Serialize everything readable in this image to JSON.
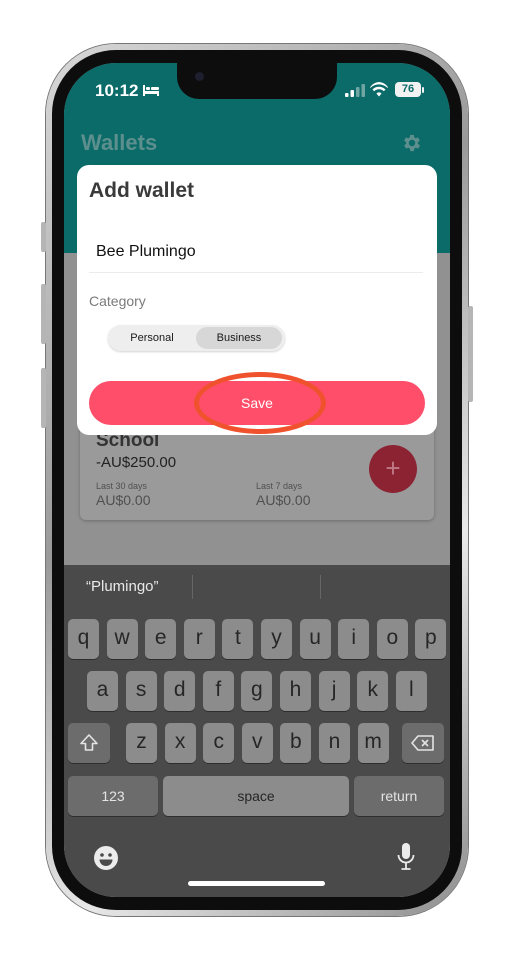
{
  "status_bar": {
    "time": "10:12",
    "battery": "76"
  },
  "app": {
    "title": "Wallets"
  },
  "wallet_card": {
    "name": "School",
    "amount": "-AU$250.00",
    "last30_label": "Last 30 days",
    "last30_value": "AU$0.00",
    "last7_label": "Last 7 days",
    "last7_value": "AU$0.00",
    "fab_label": "+"
  },
  "modal": {
    "title": "Add wallet",
    "name_value": "Bee Plumingo",
    "category_label": "Category",
    "category_options": [
      "Personal",
      "Business"
    ],
    "selected_category": "Business",
    "save_label": "Save"
  },
  "keyboard": {
    "suggestions": [
      "“Plumingo”",
      "",
      ""
    ],
    "row1": [
      "q",
      "w",
      "e",
      "r",
      "t",
      "y",
      "u",
      "i",
      "o",
      "p"
    ],
    "row2": [
      "a",
      "s",
      "d",
      "f",
      "g",
      "h",
      "j",
      "k",
      "l"
    ],
    "row3": [
      "z",
      "x",
      "c",
      "v",
      "b",
      "n",
      "m"
    ],
    "numbers_label": "123",
    "space_label": "space",
    "return_label": "return"
  },
  "colors": {
    "header": "#0b6b69",
    "accent": "#ff4e6a",
    "highlight_ring": "#f0522d"
  },
  "icons": [
    "bed-icon",
    "signal-icon",
    "wifi-icon",
    "battery-icon",
    "gear-icon",
    "shift-icon",
    "backspace-icon",
    "emoji-icon",
    "microphone-icon"
  ]
}
